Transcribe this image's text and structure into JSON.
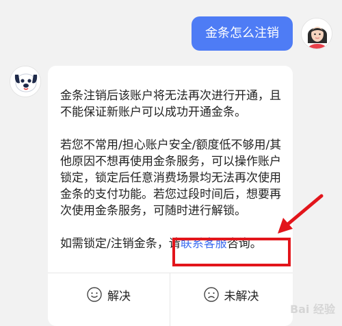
{
  "user_message": "金条怎么注销",
  "bot_reply": {
    "para1": "金条注销后该账户将无法再次进行开通，且不能保证新账户可以成功开通金条。",
    "para2": "若您不常用/担心账户安全/额度低不够用/其他原因不想再使用金条服务，可以操作账户锁定，锁定后任意消费场景均无法再次使用金条的支付功能。若您过段时间后，想要再次使用金条服务，可随时进行解锁。",
    "para3_prefix": "如需锁定/注销金条，请",
    "para3_link": "联系客服",
    "para3_suffix": "咨询。"
  },
  "feedback": {
    "solved_label": "解决",
    "unsolved_label": "未解决",
    "solved_icon": "smile-face-icon",
    "unsolved_icon": "sad-face-icon"
  },
  "watermark": "Bai 经验",
  "colors": {
    "user_bubble": "#4e7cf5",
    "link": "#3d6df0",
    "annotation_red": "#e2151b",
    "background": "#f2f2f2"
  }
}
